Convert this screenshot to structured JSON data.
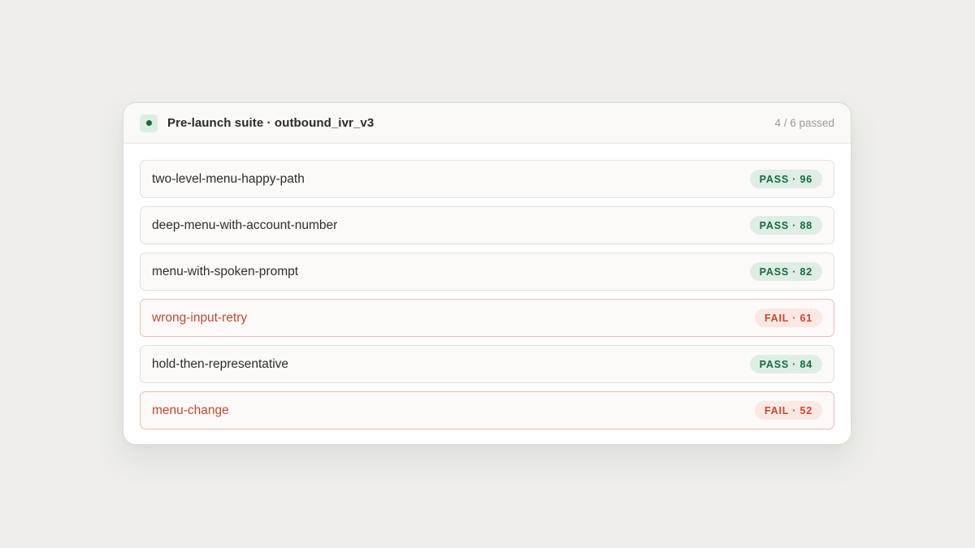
{
  "suite": {
    "title": "Pre-launch suite · outbound_ivr_v3",
    "summary": "4 / 6 passed",
    "status_icon": "status-dot-icon",
    "accent_color": "#136b3f"
  },
  "colors": {
    "pass": "#146b40",
    "pass_bg": "#deeee4",
    "fail": "#c9472d",
    "fail_bg": "#fbe8e3"
  },
  "tests": [
    {
      "name": "two-level-menu-happy-path",
      "status": "pass",
      "badge": "PASS · 96"
    },
    {
      "name": "deep-menu-with-account-number",
      "status": "pass",
      "badge": "PASS · 88"
    },
    {
      "name": "menu-with-spoken-prompt",
      "status": "pass",
      "badge": "PASS · 82"
    },
    {
      "name": "wrong-input-retry",
      "status": "fail",
      "badge": "FAIL · 61"
    },
    {
      "name": "hold-then-representative",
      "status": "pass",
      "badge": "PASS · 84"
    },
    {
      "name": "menu-change",
      "status": "fail",
      "badge": "FAIL · 52"
    }
  ]
}
